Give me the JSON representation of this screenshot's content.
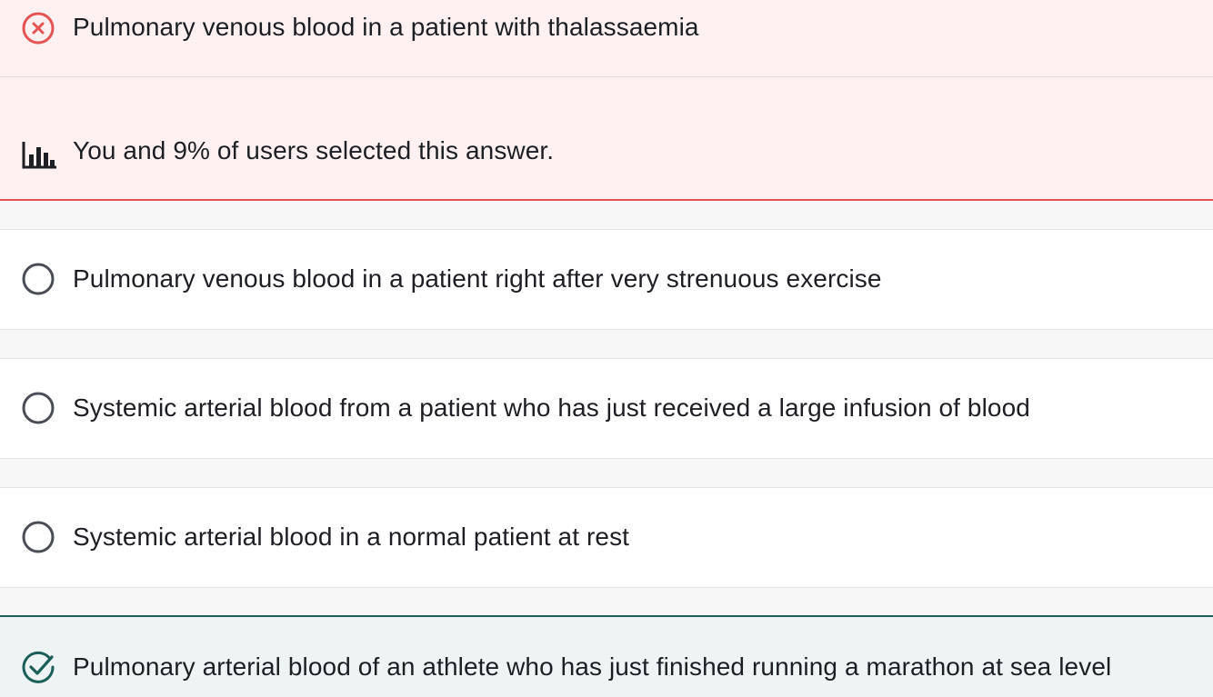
{
  "answers": [
    {
      "label": "Pulmonary venous blood in a patient with thalassaemia",
      "state": "incorrect-selected",
      "stats_text": "You and 9% of users selected this answer."
    },
    {
      "label": "Pulmonary venous blood in a patient right after very strenuous exercise",
      "state": "unselected"
    },
    {
      "label": "Systemic arterial blood from a patient who has just received a large infusion of blood",
      "state": "unselected"
    },
    {
      "label": "Systemic arterial blood in a normal patient at rest",
      "state": "unselected"
    },
    {
      "label": "Pulmonary arterial blood of an athlete who has just finished running a marathon at sea level",
      "state": "correct"
    }
  ],
  "icons": {
    "incorrect": "x-circle-icon",
    "stats": "bar-chart-icon",
    "unselected": "radio-circle-icon",
    "correct": "check-circle-icon"
  },
  "colors": {
    "incorrect_accent": "#e55454",
    "incorrect_bg": "#fff0f2",
    "correct_accent": "#1b5f58",
    "correct_bg": "#eef4f4",
    "radio_stroke": "#4a4d55",
    "text": "#1d1f24"
  }
}
